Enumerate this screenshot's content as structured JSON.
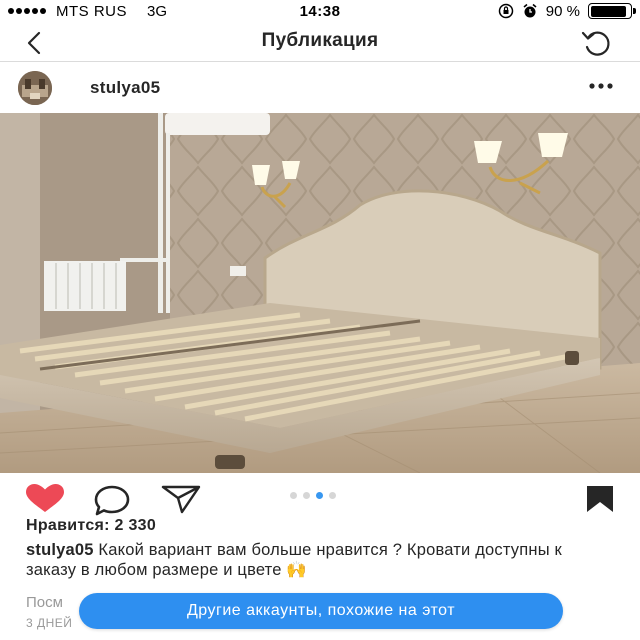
{
  "status_bar": {
    "carrier": "MTS RUS",
    "network": "3G",
    "time": "14:38",
    "battery": "90 %",
    "battery_level": 0.9
  },
  "nav": {
    "title": "Публикация",
    "back_icon": "chevron-left-icon",
    "refresh_icon": "refresh-icon"
  },
  "post": {
    "username": "stulya05",
    "more_icon": "more-icon",
    "likes": "Нравится: 2 330",
    "caption_user": "stulya05",
    "caption_text": " Какой вариант вам больше нравится ? Кровати доступны к заказу в любом размере и цвете 🙌",
    "view_link": "Посм",
    "time_ago": "3 ДНЕЙ",
    "carousel": {
      "count": 4,
      "active_index": 2
    },
    "liked": true,
    "accent_color": "#2e8ff0",
    "like_color": "#ed4956"
  },
  "floating_button": {
    "label": "Другие аккаунты, похожие на этот"
  }
}
